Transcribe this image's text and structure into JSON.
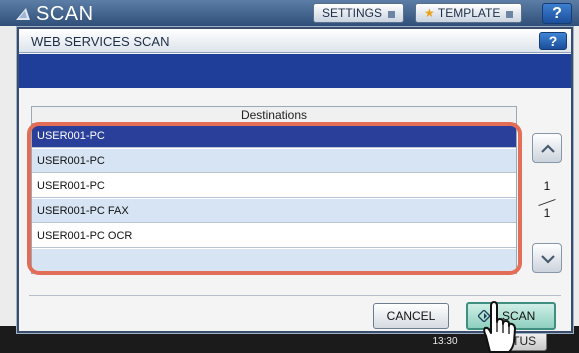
{
  "background_screen": {
    "title": "SCAN",
    "settings_label": "SETTINGS",
    "template_label": "TEMPLATE",
    "help_label": "?",
    "status_label": "ATUS",
    "clock_partial": "13:30"
  },
  "dialog": {
    "title": "WEB SERVICES SCAN",
    "help_label": "?",
    "destinations_header": "Destinations",
    "destinations": [
      {
        "label": "USER001-PC",
        "selected": true
      },
      {
        "label": "USER001-PC",
        "selected": false
      },
      {
        "label": "USER001-PC",
        "selected": false
      },
      {
        "label": "USER001-PC FAX",
        "selected": false
      },
      {
        "label": "USER001-PC OCR",
        "selected": false
      },
      {
        "label": "",
        "selected": false
      }
    ],
    "page_current": "1",
    "page_total": "1",
    "cancel_label": "CANCEL",
    "scan_label": "SCAN"
  },
  "colors": {
    "highlight_ring": "#e26e57",
    "selected_row": "#2a3f9a",
    "alt_row": "#d6e4f3",
    "title_bar_blue": "#1f3e9a",
    "scan_button": "#8fcfc0"
  },
  "icons": [
    "scanner-icon",
    "star-icon",
    "chevron-down-icon",
    "help-icon",
    "scroll-up-icon",
    "scroll-down-icon",
    "scan-diamond-icon",
    "hand-cursor-icon"
  ]
}
